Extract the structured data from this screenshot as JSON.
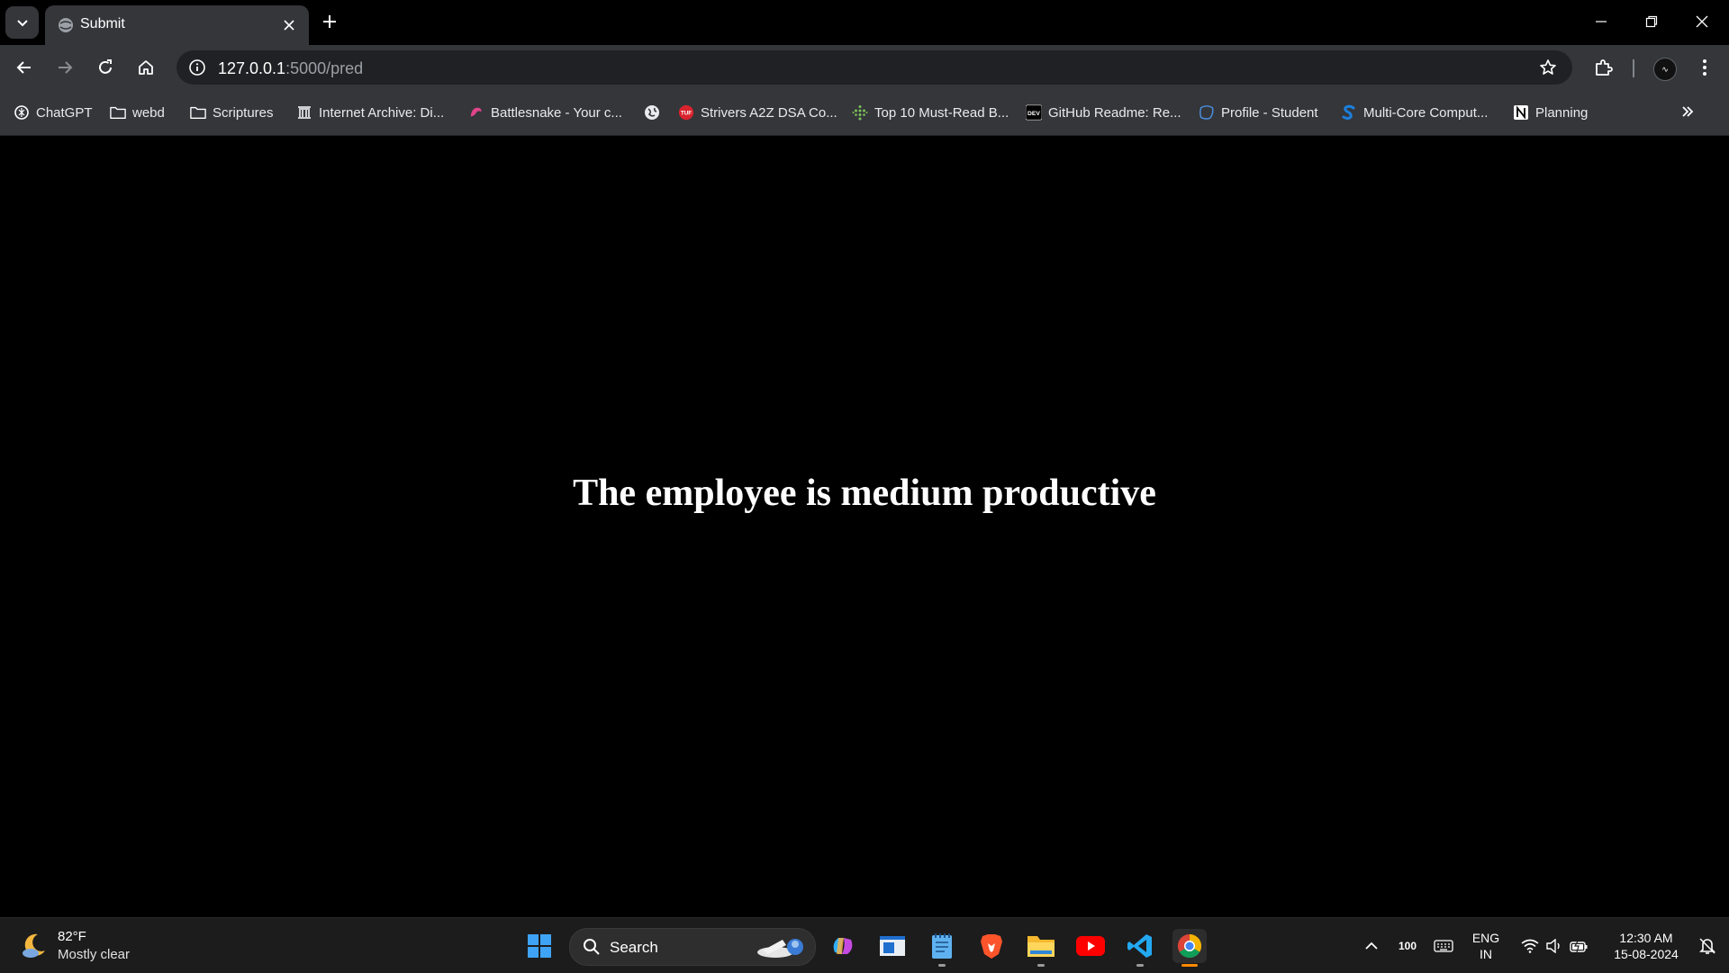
{
  "browser": {
    "tab": {
      "title": "Submit"
    },
    "address": {
      "host": "127.0.0.1",
      "path": ":5000/pred"
    },
    "profile_initials": "∿"
  },
  "bookmarks": [
    {
      "label": "ChatGPT",
      "icon": "chatgpt-icon"
    },
    {
      "label": "webd",
      "icon": "folder-icon"
    },
    {
      "label": "Scriptures",
      "icon": "folder-icon"
    },
    {
      "label": "Internet Archive: Di...",
      "icon": "archive-icon"
    },
    {
      "label": "Battlesnake - Your c...",
      "icon": "battlesnake-icon"
    },
    {
      "label": "",
      "icon": "globe-icon"
    },
    {
      "label": "Strivers A2Z DSA Co...",
      "icon": "tuf-icon"
    },
    {
      "label": "Top 10 Must-Read B...",
      "icon": "dots-icon"
    },
    {
      "label": "GitHub Readme: Re...",
      "icon": "dev-icon"
    },
    {
      "label": "Profile - Student",
      "icon": "profile-icon"
    },
    {
      "label": "Multi-Core Comput...",
      "icon": "s-icon"
    },
    {
      "label": "Planning",
      "icon": "notion-icon"
    }
  ],
  "page": {
    "heading": "The employee is medium productive"
  },
  "taskbar": {
    "weather": {
      "temp": "82°F",
      "desc": "Mostly clear"
    },
    "search_label": "Search",
    "tray": {
      "battery": "100",
      "lang1": "ENG",
      "lang2": "IN",
      "time": "12:30 AM",
      "date": "15-08-2024"
    }
  },
  "colors": {
    "tab_bg": "#35363a",
    "page_bg": "#000000",
    "accent_orange": "#ff8a00"
  }
}
